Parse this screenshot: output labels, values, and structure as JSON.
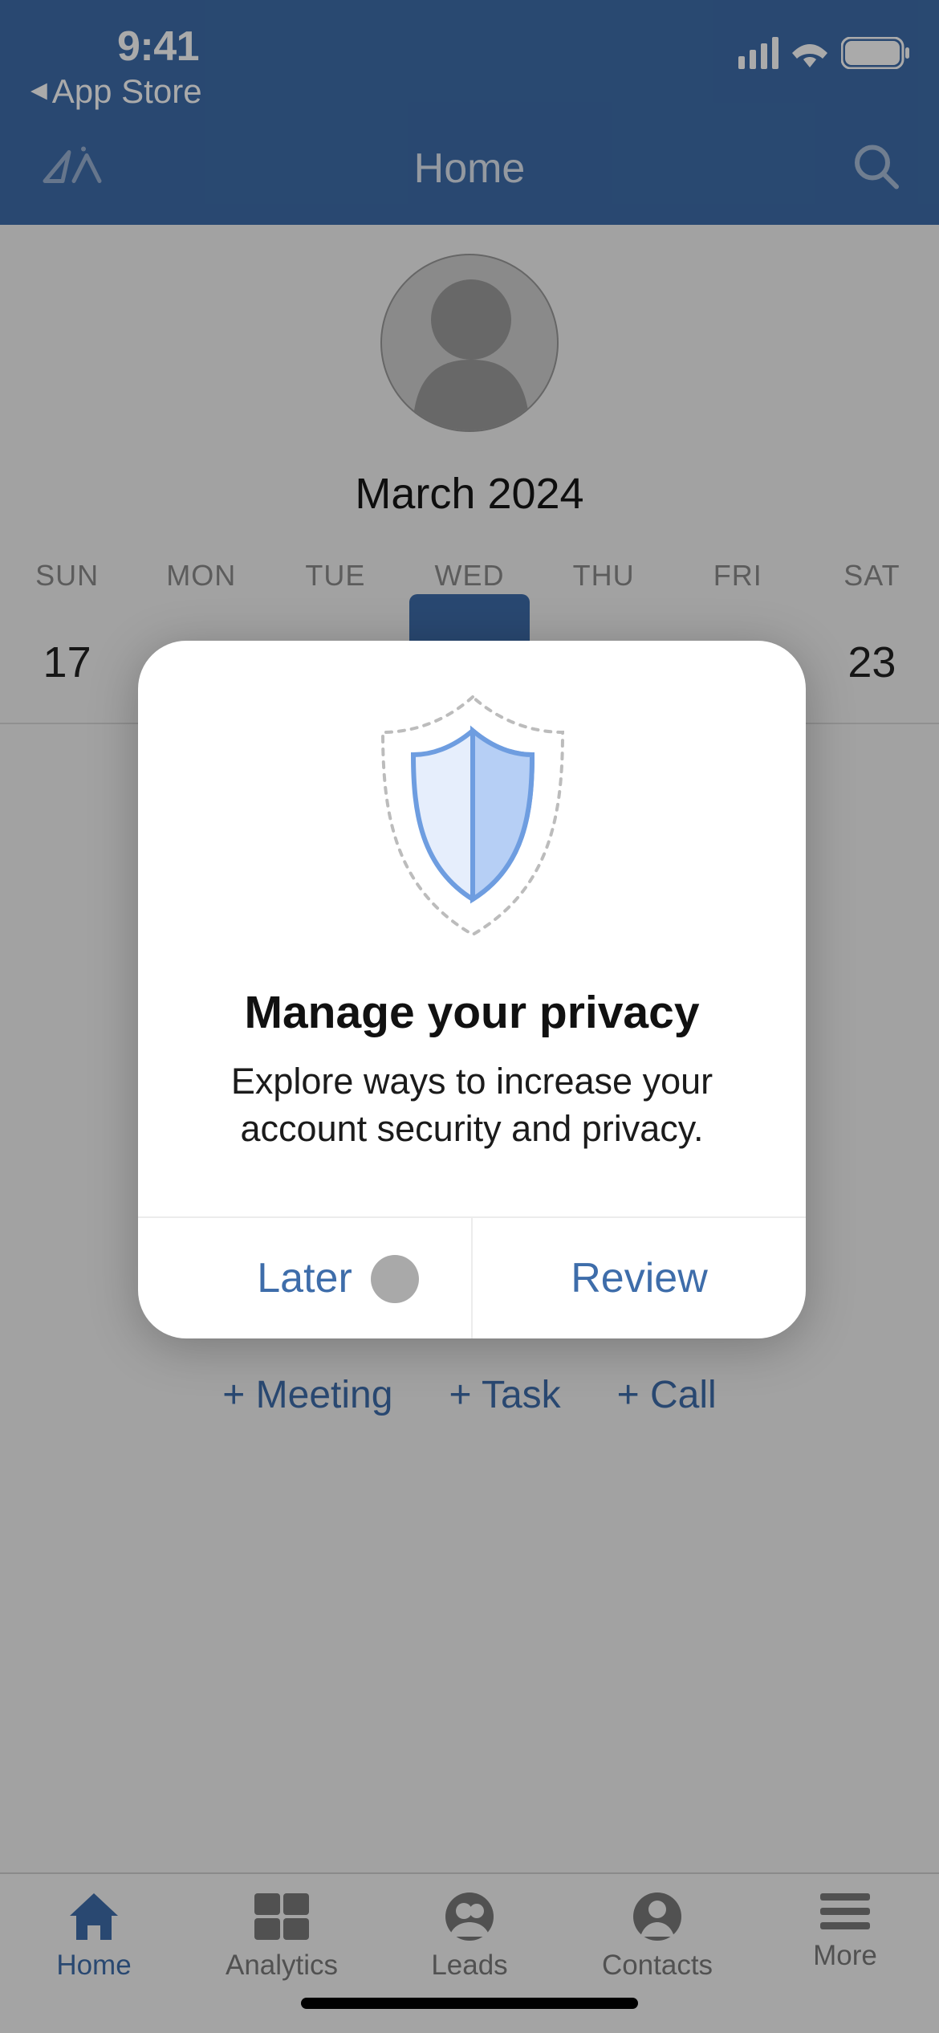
{
  "status": {
    "time": "9:41",
    "back_to": "App Store"
  },
  "nav": {
    "title": "Home"
  },
  "calendar": {
    "month_label": "March 2024",
    "day_abbrevs": [
      "SUN",
      "MON",
      "TUE",
      "WED",
      "THU",
      "FRI",
      "SAT"
    ],
    "dates": [
      "17",
      "",
      "",
      "",
      "",
      "",
      "23"
    ],
    "selected_index": 3
  },
  "quick_actions": {
    "meeting": "+ Meeting",
    "task": "+ Task",
    "call": "+ Call"
  },
  "tabs": {
    "home": "Home",
    "analytics": "Analytics",
    "leads": "Leads",
    "contacts": "Contacts",
    "more": "More",
    "active": "home"
  },
  "modal": {
    "title": "Manage your privacy",
    "subtitle": "Explore ways to increase your account security and privacy.",
    "later": "Later",
    "review": "Review"
  }
}
